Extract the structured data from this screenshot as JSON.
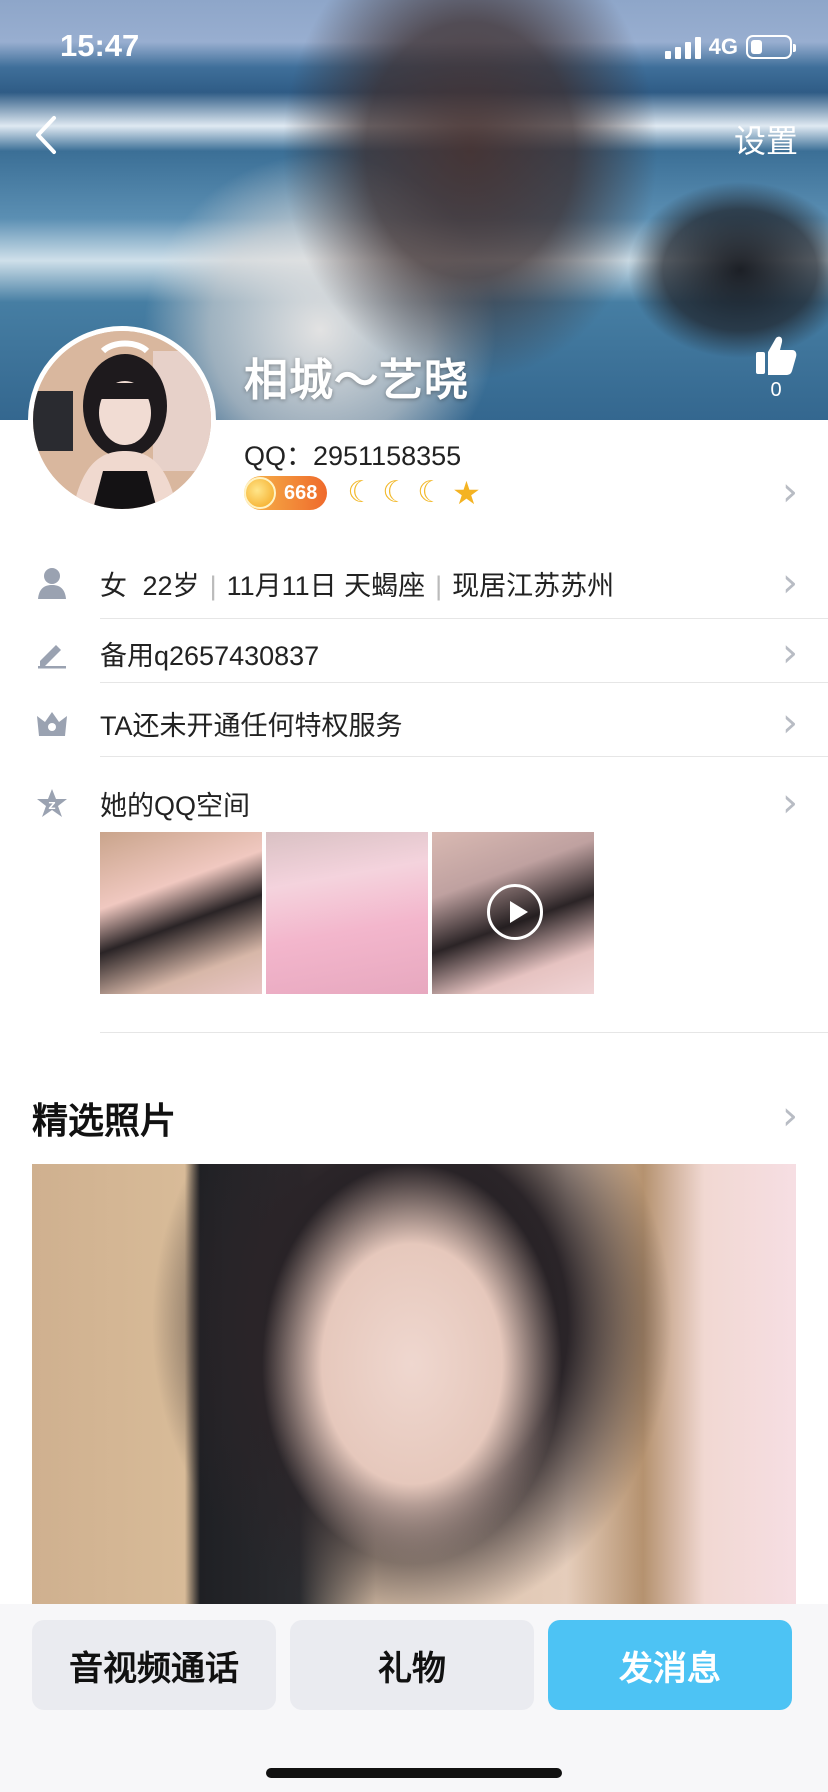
{
  "status_bar": {
    "time": "15:47",
    "network": "4G"
  },
  "nav": {
    "settings_label": "设置"
  },
  "profile": {
    "name": "相城～艺晓",
    "like_count": "0",
    "qq_number": "QQ：2951158355",
    "coin_level": "668"
  },
  "info_rows": {
    "basic": {
      "gender": "女",
      "age": "22岁",
      "birthday": "11月11日 天蝎座",
      "location": "现居江苏苏州"
    },
    "signature": "备用q2657430837",
    "privilege": "TA还未开通任何特权服务",
    "qzone": "她的QQ空间"
  },
  "featured": {
    "title": "精选照片"
  },
  "actions": {
    "call_label": "音视频通话",
    "gift_label": "礼物",
    "message_label": "发消息"
  },
  "colors": {
    "accent": "#4dc3f4",
    "coin": "#ef6a2c",
    "moon": "#f2b92b"
  },
  "icons": [
    "back-icon",
    "thumbs-up-icon",
    "person-icon",
    "pencil-icon",
    "crown-icon",
    "qzone-star-icon",
    "chevron-right-icon",
    "play-icon"
  ]
}
